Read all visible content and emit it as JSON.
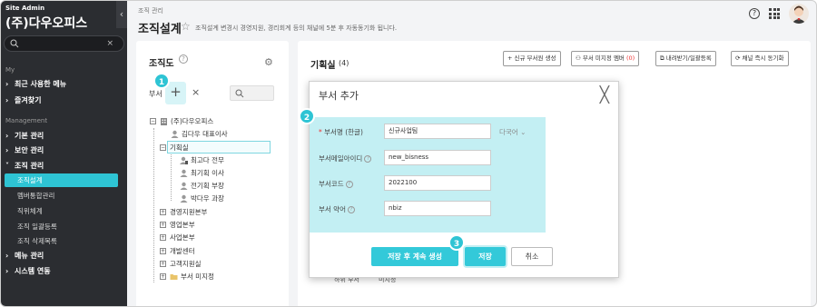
{
  "sidebar": {
    "site_label": "Site Admin",
    "company": "(주)다우오피스",
    "collapse": "‹",
    "search_clear": "×",
    "sections": {
      "my": "My",
      "management": "Management"
    },
    "items": {
      "recent": "최근 사용한 메뉴",
      "favorites": "즐겨찾기",
      "basic": "기본 관리",
      "security": "보안 관리",
      "org": "조직 관리",
      "menu": "메뉴 관리",
      "system": "시스템 연동"
    },
    "org_sub": [
      "조직설계",
      "멤버통합관리",
      "직위체계",
      "조직 일괄등록",
      "조직 삭제목록"
    ]
  },
  "header": {
    "breadcrumb": "조직 관리",
    "title": "조직설계",
    "description": "조직설계 변경시 경영지원, 경리회계 등의 채널에 5분 후 자동동기화 됩니다.",
    "help": "?"
  },
  "org_panel": {
    "title": "조직도",
    "dept_label": "부서",
    "add": "+",
    "remove": "×",
    "tree": {
      "root": "(주)다우오피스",
      "ceo": "김다우 대표이사",
      "planning": "기획실",
      "planning_members": [
        "최고다 전무",
        "최기획 이사",
        "전기획 부장",
        "박다우 과장"
      ],
      "depts": [
        "경영지원본부",
        "영업본부",
        "사업본부",
        "개발센터",
        "고객지원실"
      ],
      "unassigned": "부서 미지정"
    }
  },
  "dept_panel": {
    "title": "기획실",
    "count": "(4)",
    "buttons": {
      "new_member": "신규 부서원 생성",
      "unassigned_member": "부서 미지정 멤버",
      "unassigned_count": "(0)",
      "download": "내려받기/일괄등록",
      "sync": "채널 즉시 동기화"
    },
    "bottom_left": "하위 부서",
    "bottom_right": "미지정"
  },
  "modal": {
    "title": "부서 추가",
    "close": "╳",
    "fields": {
      "name_label": "부서명 (한글)",
      "name_required": "*",
      "name_value": "신규사업팀",
      "lang": "다국어 ⌄",
      "email_label": "부서메일아이디",
      "email_value": "new_bisness",
      "code_label": "부서코드",
      "code_value": "2022100",
      "abbr_label": "부서 약어",
      "abbr_value": "nbiz"
    },
    "buttons": {
      "save_continue": "저장 후 계속 생성",
      "save": "저장",
      "cancel": "취소"
    }
  },
  "callouts": [
    "1",
    "2",
    "3"
  ],
  "colors": {
    "accent": "#2ec4d4",
    "sidebar_bg": "#2b2d31",
    "highlight": "#c3eff3"
  }
}
